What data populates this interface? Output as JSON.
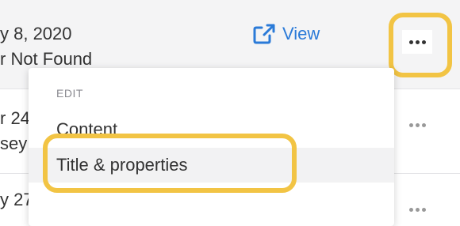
{
  "table": {
    "rows": [
      {
        "date": "y 8, 2020",
        "subtext": "r Not Found",
        "view_label": "View"
      },
      {
        "date": "r 24",
        "subtext": "sey"
      },
      {
        "date": "y 27"
      }
    ]
  },
  "menu": {
    "section_label": "EDIT",
    "items": [
      {
        "label": "Content"
      },
      {
        "label": "Title & properties"
      }
    ]
  },
  "colors": {
    "highlight": "#f2c444",
    "link": "#2a7ad8"
  },
  "icons": {
    "view": "external-link-icon",
    "more": "more-dots-icon"
  }
}
